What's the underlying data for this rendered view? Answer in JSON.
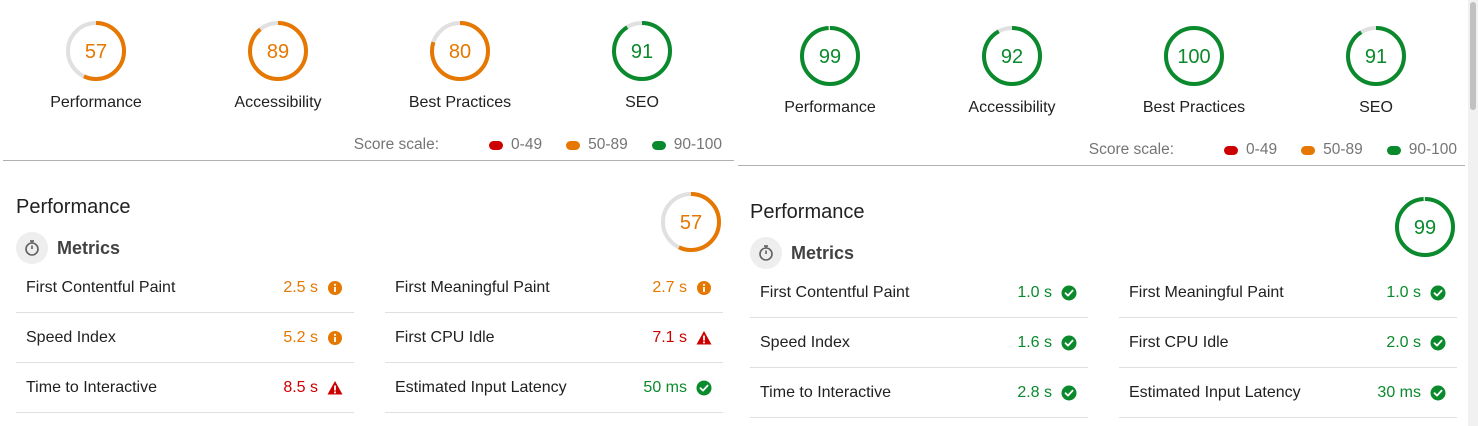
{
  "colors": {
    "fail": "#cc0000",
    "average": "#e67700",
    "pass": "#0a8a2c",
    "track": "#e0e0e0"
  },
  "left": {
    "gauges": [
      {
        "label": "Performance",
        "score": 57,
        "status": "average"
      },
      {
        "label": "Accessibility",
        "score": 89,
        "status": "average"
      },
      {
        "label": "Best Practices",
        "score": 80,
        "status": "average"
      },
      {
        "label": "SEO",
        "score": 91,
        "status": "pass"
      }
    ],
    "score_scale": {
      "title": "Score scale:",
      "ranges": [
        "0-49",
        "50-89",
        "90-100"
      ]
    },
    "section": {
      "title": "Performance",
      "score": 57,
      "status": "average"
    },
    "metrics": {
      "title": "Metrics",
      "col1": [
        {
          "name": "First Contentful Paint",
          "value": "2.5 s",
          "status": "average"
        },
        {
          "name": "Speed Index",
          "value": "5.2 s",
          "status": "average"
        },
        {
          "name": "Time to Interactive",
          "value": "8.5 s",
          "status": "fail"
        }
      ],
      "col2": [
        {
          "name": "First Meaningful Paint",
          "value": "2.7 s",
          "status": "average"
        },
        {
          "name": "First CPU Idle",
          "value": "7.1 s",
          "status": "fail"
        },
        {
          "name": "Estimated Input Latency",
          "value": "50 ms",
          "status": "pass"
        }
      ]
    }
  },
  "right": {
    "gauges": [
      {
        "label": "Performance",
        "score": 99,
        "status": "pass"
      },
      {
        "label": "Accessibility",
        "score": 92,
        "status": "pass"
      },
      {
        "label": "Best Practices",
        "score": 100,
        "status": "pass"
      },
      {
        "label": "SEO",
        "score": 91,
        "status": "pass"
      }
    ],
    "score_scale": {
      "title": "Score scale:",
      "ranges": [
        "0-49",
        "50-89",
        "90-100"
      ]
    },
    "section": {
      "title": "Performance",
      "score": 99,
      "status": "pass"
    },
    "metrics": {
      "title": "Metrics",
      "col1": [
        {
          "name": "First Contentful Paint",
          "value": "1.0 s",
          "status": "pass"
        },
        {
          "name": "Speed Index",
          "value": "1.6 s",
          "status": "pass"
        },
        {
          "name": "Time to Interactive",
          "value": "2.8 s",
          "status": "pass"
        }
      ],
      "col2": [
        {
          "name": "First Meaningful Paint",
          "value": "1.0 s",
          "status": "pass"
        },
        {
          "name": "First CPU Idle",
          "value": "2.0 s",
          "status": "pass"
        },
        {
          "name": "Estimated Input Latency",
          "value": "30 ms",
          "status": "pass"
        }
      ]
    }
  }
}
